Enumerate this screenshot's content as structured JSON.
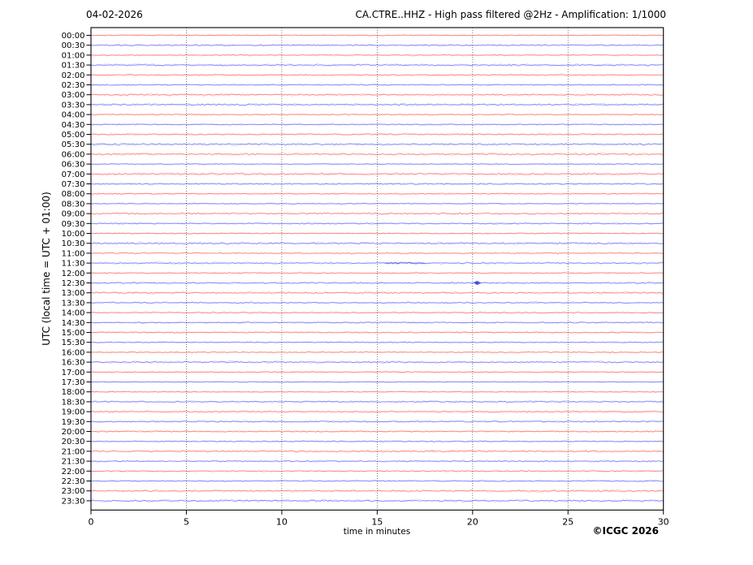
{
  "figure": {
    "date_label": "04-02-2026",
    "title": "CA.CTRE..HHZ - High pass filtered @2Hz - Amplification: 1/1000",
    "xlabel": "time in minutes",
    "ylabel": "UTC (local time = UTC + 01:00)",
    "copyright": "©ICGC 2026"
  },
  "chart_data": {
    "type": "line",
    "subtype": "helicorder-seismogram",
    "title": "CA.CTRE..HHZ - High pass filtered @2Hz - Amplification: 1/1000",
    "date": "04-02-2026",
    "xlabel": "time in minutes",
    "ylabel": "UTC (local time = UTC + 01:00)",
    "xlim": [
      0,
      30
    ],
    "x_ticks": [
      0,
      5,
      10,
      15,
      20,
      25,
      30
    ],
    "x_tick_labels": [
      "0",
      "5",
      "10",
      "15",
      "20",
      "25",
      "30"
    ],
    "grid": "vertical dotted lines at 5-minute intervals",
    "row_interval_minutes": 30,
    "colors": {
      "red": "#ff0000",
      "blue": "#0000ff",
      "event": "#1515cc"
    },
    "rows": [
      {
        "label": "00:00",
        "color": "red"
      },
      {
        "label": "00:30",
        "color": "blue"
      },
      {
        "label": "01:00",
        "color": "red"
      },
      {
        "label": "01:30",
        "color": "blue"
      },
      {
        "label": "02:00",
        "color": "red"
      },
      {
        "label": "02:30",
        "color": "blue"
      },
      {
        "label": "03:00",
        "color": "red"
      },
      {
        "label": "03:30",
        "color": "blue"
      },
      {
        "label": "04:00",
        "color": "red"
      },
      {
        "label": "04:30",
        "color": "blue"
      },
      {
        "label": "05:00",
        "color": "red"
      },
      {
        "label": "05:30",
        "color": "blue"
      },
      {
        "label": "06:00",
        "color": "red"
      },
      {
        "label": "06:30",
        "color": "blue"
      },
      {
        "label": "07:00",
        "color": "red"
      },
      {
        "label": "07:30",
        "color": "blue"
      },
      {
        "label": "08:00",
        "color": "red"
      },
      {
        "label": "08:30",
        "color": "blue"
      },
      {
        "label": "09:00",
        "color": "red"
      },
      {
        "label": "09:30",
        "color": "blue"
      },
      {
        "label": "10:00",
        "color": "red"
      },
      {
        "label": "10:30",
        "color": "blue"
      },
      {
        "label": "11:00",
        "color": "red"
      },
      {
        "label": "11:30",
        "color": "blue"
      },
      {
        "label": "12:00",
        "color": "red"
      },
      {
        "label": "12:30",
        "color": "blue"
      },
      {
        "label": "13:00",
        "color": "red"
      },
      {
        "label": "13:30",
        "color": "blue"
      },
      {
        "label": "14:00",
        "color": "red"
      },
      {
        "label": "14:30",
        "color": "blue"
      },
      {
        "label": "15:00",
        "color": "red"
      },
      {
        "label": "15:30",
        "color": "blue"
      },
      {
        "label": "16:00",
        "color": "red"
      },
      {
        "label": "16:30",
        "color": "blue"
      },
      {
        "label": "17:00",
        "color": "red"
      },
      {
        "label": "17:30",
        "color": "blue"
      },
      {
        "label": "18:00",
        "color": "red"
      },
      {
        "label": "18:30",
        "color": "blue"
      },
      {
        "label": "19:00",
        "color": "red"
      },
      {
        "label": "19:30",
        "color": "blue"
      },
      {
        "label": "20:00",
        "color": "red"
      },
      {
        "label": "20:30",
        "color": "blue"
      },
      {
        "label": "21:00",
        "color": "red"
      },
      {
        "label": "21:30",
        "color": "blue"
      },
      {
        "label": "22:00",
        "color": "red"
      },
      {
        "label": "22:30",
        "color": "blue"
      },
      {
        "label": "23:00",
        "color": "red"
      },
      {
        "label": "23:30",
        "color": "blue"
      }
    ],
    "events": [
      {
        "row_label": "11:30",
        "start_minute": 15.4,
        "end_minute": 17.6,
        "kind": "elevated-amplitude"
      },
      {
        "row_label": "12:30",
        "minute": 20.25,
        "kind": "spike"
      }
    ]
  }
}
